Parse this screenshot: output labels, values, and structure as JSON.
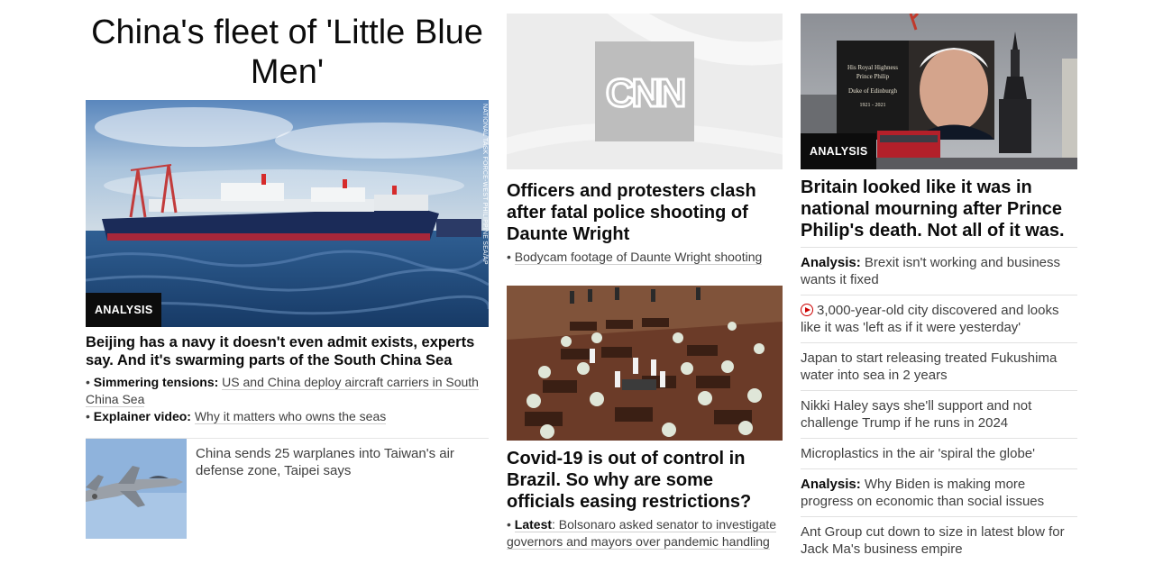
{
  "hero": {
    "title": "China's fleet of 'Little Blue Men'",
    "badge": "ANALYSIS",
    "photo_credit": "NATIONAL TASK FORCE-WEST PHILIPPINE SEA/AP",
    "headline": "Beijing has a navy it doesn't even admit exists, experts say. And it's swarming parts of the South China Sea",
    "subs": [
      {
        "prefix": "Simmering tensions:",
        "text": "US and China deploy aircraft carriers in South China Sea"
      },
      {
        "prefix": "Explainer video:",
        "text": "Why it matters who owns the seas"
      }
    ],
    "related": {
      "text": "China sends 25 warplanes into Taiwan's air defense zone, Taipei says",
      "thumb_icon": "fighter-jet-icon"
    }
  },
  "middle": {
    "cnn_logo": "CNN",
    "officers": {
      "headline": "Officers and protesters clash after fatal police shooting of Daunte Wright",
      "sub": "Bodycam footage of Daunte Wright shooting"
    },
    "covid": {
      "headline": "Covid-19 is out of control in Brazil. So why are some officials easing restrictions?",
      "sub_prefix": "Latest",
      "sub_text": ": Bolsonaro asked senator to investigate governors and mayors over pandemic handling"
    }
  },
  "right": {
    "badge": "ANALYSIS",
    "billboard": {
      "line1": "His Royal Highness",
      "line2": "Prince Philip",
      "line3": "Duke of Edinburgh",
      "years": "1921 - 2021"
    },
    "headline": "Britain looked like it was in national mourning after Prince Philip's death. Not all of it was.",
    "items": [
      {
        "prefix": "Analysis:",
        "text": "Brexit isn't working and business wants it fixed"
      },
      {
        "prefix": "",
        "text": "3,000-year-old city discovered and looks like it was 'left as if it were yesterday'",
        "icon": "play-icon"
      },
      {
        "prefix": "",
        "text": "Japan to start releasing treated Fukushima water into sea in 2 years"
      },
      {
        "prefix": "",
        "text": "Nikki Haley says she'll support and not challenge Trump if he runs in 2024"
      },
      {
        "prefix": "",
        "text": "Microplastics in the air 'spiral the globe'"
      },
      {
        "prefix": "Analysis:",
        "text": "Why Biden is making more progress on economic than social issues"
      },
      {
        "prefix": "",
        "text": "Ant Group cut down to size in latest blow for Jack Ma's business empire"
      }
    ]
  },
  "colors": {
    "badge_bg": "#0c0c0c",
    "accent_red": "#cc0000",
    "text": "#0c0c0c"
  }
}
